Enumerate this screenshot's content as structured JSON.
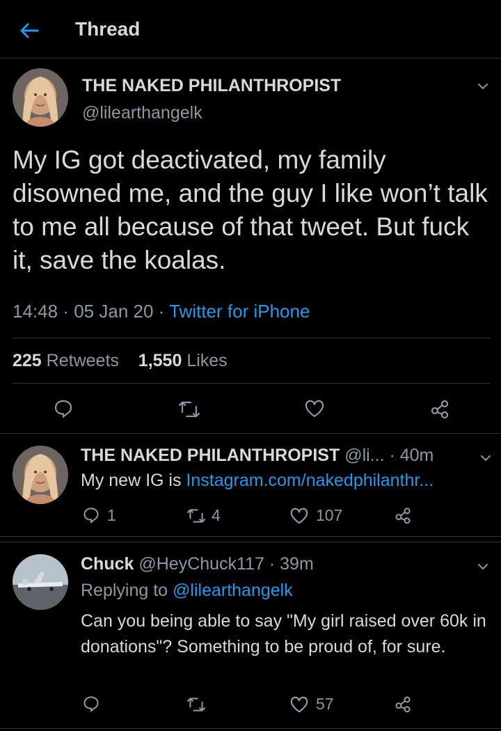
{
  "header": {
    "title": "Thread"
  },
  "main_tweet": {
    "display_name": "THE NAKED PHILANTHROPIST",
    "handle": "@lilearthangelk",
    "text": "My IG got deactivated, my family disowned me, and the guy I like won’t talk to me all because of that tweet. But fuck it, save the koalas.",
    "time": "14:48",
    "dot1": "·",
    "date": "05 Jan 20",
    "dot2": "·",
    "source": "Twitter for iPhone",
    "retweets_count": "225",
    "retweets_label": "Retweets",
    "likes_count": "1,550",
    "likes_label": "Likes"
  },
  "reply1": {
    "display_name": "THE NAKED PHILANTHROPIST",
    "handle": "@li...",
    "time": "· 40m",
    "text_prefix": "My new IG is ",
    "link": "Instagram.com/nakedphilanthr...",
    "replies": "1",
    "retweets": "4",
    "likes": "107"
  },
  "reply2": {
    "display_name": "Chuck",
    "handle": "@HeyChuck117",
    "time": "· 39m",
    "replying_label": "Replying to",
    "replying_to": "@lilearthangelk",
    "text": "Can you being able to say \"My girl raised over 60k in donations\"? Something to be proud of, for sure.",
    "likes": "57"
  },
  "colors": {
    "accent": "#1d9bf0",
    "muted": "#8b98a5",
    "text": "#d9d9d9",
    "bg": "#000000"
  },
  "icons": [
    "back-arrow-icon",
    "chevron-down-icon",
    "reply-icon",
    "retweet-icon",
    "like-icon",
    "share-icon"
  ]
}
